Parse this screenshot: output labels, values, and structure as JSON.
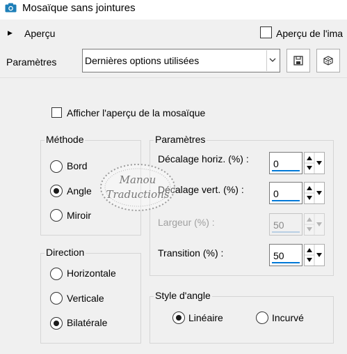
{
  "window": {
    "title": "Mosaïque sans jointures",
    "icon": "camera-icon"
  },
  "preview": {
    "toggle_label": "Aperçu",
    "toggle_icon": "triangle-right-icon",
    "image_preview_label": "Aperçu de l'ima",
    "image_preview_checked": false
  },
  "parameters_bar": {
    "label": "Paramètres",
    "preset_value": "Dernières options utilisées",
    "preset_icon": "chevron-down-icon",
    "save_icon": "save-icon",
    "random_icon": "dice-icon"
  },
  "show_tile_preview": {
    "label": "Afficher l'aperçu de la mosaïque",
    "checked": false
  },
  "method": {
    "title": "Méthode",
    "options": [
      {
        "label": "Bord",
        "selected": false
      },
      {
        "label": "Angle",
        "selected": true
      },
      {
        "label": "Miroir",
        "selected": false
      }
    ]
  },
  "direction": {
    "title": "Direction",
    "options": [
      {
        "label": "Horizontale",
        "selected": false
      },
      {
        "label": "Verticale",
        "selected": false
      },
      {
        "label": "Bilatérale",
        "selected": true
      }
    ]
  },
  "params": {
    "title": "Paramètres",
    "horiz_offset": {
      "label": "Décalage horiz. (%) :",
      "value": "0"
    },
    "vert_offset": {
      "label": "Décalage vert. (%) :",
      "value": "0"
    },
    "width": {
      "label": "Largeur (%) :",
      "value": "50",
      "disabled": true
    },
    "transition": {
      "label": "Transition (%) :",
      "value": "50"
    }
  },
  "corner_style": {
    "title": "Style d'angle",
    "options": [
      {
        "label": "Linéaire",
        "selected": true
      },
      {
        "label": "Incurvé",
        "selected": false
      }
    ]
  },
  "watermark": {
    "line1": "Manou",
    "line2": "Traductions"
  },
  "colors": {
    "accent": "#0078d7",
    "panel": "#f0f0f0",
    "icon": "#1e7fb8"
  }
}
